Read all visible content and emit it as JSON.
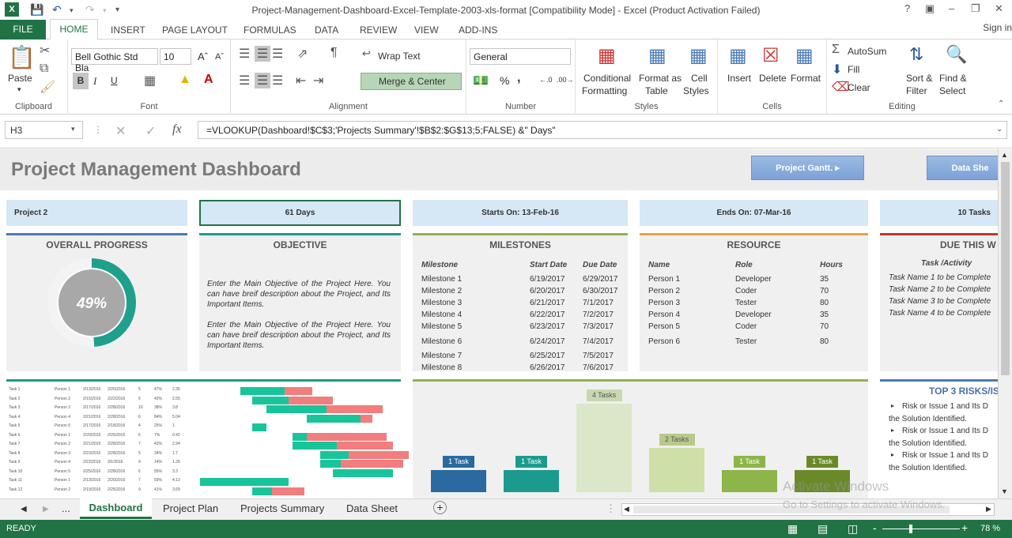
{
  "window": {
    "title": "Project-Management-Dashboard-Excel-Template-2003-xls-format  [Compatibility Mode] - Excel (Product Activation Failed)",
    "help": "?"
  },
  "tabs": {
    "file": "FILE",
    "items": [
      "HOME",
      "INSERT",
      "PAGE LAYOUT",
      "FORMULAS",
      "DATA",
      "REVIEW",
      "VIEW",
      "ADD-INS"
    ],
    "signin": "Sign in"
  },
  "ribbon": {
    "clipboard": {
      "paste": "Paste",
      "label": "Clipboard"
    },
    "font": {
      "family": "Bell Gothic Std Bla",
      "size": "10",
      "label": "Font",
      "bold": "B",
      "italic": "I",
      "underline": "U"
    },
    "alignment": {
      "wrap": "Wrap Text",
      "merge": "Merge & Center",
      "label": "Alignment"
    },
    "number": {
      "format": "General",
      "percent": "%",
      "comma": ",",
      "label": "Number"
    },
    "styles": {
      "conditional": [
        "Conditional",
        "Formatting"
      ],
      "format_table": [
        "Format as",
        "Table"
      ],
      "cell_styles": [
        "Cell",
        "Styles"
      ],
      "label": "Styles"
    },
    "cells": {
      "insert": "Insert",
      "delete": "Delete",
      "format": "Format",
      "label": "Cells"
    },
    "editing": {
      "autosum": "AutoSum",
      "fill": "Fill",
      "clear": "Clear",
      "sort": [
        "Sort &",
        "Filter"
      ],
      "find": [
        "Find &",
        "Select"
      ],
      "label": "Editing"
    }
  },
  "formula_bar": {
    "name_box": "H3",
    "formula": "=VLOOKUP(Dashboard!$C$3;'Projects Summary'!$B$2:$G$13;5;FALSE) &\" Days\""
  },
  "dashboard": {
    "title": "Project Management Dashboard",
    "buttons": [
      "Project Gantt.",
      "Data She"
    ],
    "kpis": [
      "Project 2",
      "61 Days",
      "Starts On: 13-Feb-16",
      "Ends On: 07-Mar-16",
      "10 Tasks"
    ],
    "progress": {
      "title": "OVERALL PROGRESS",
      "value": "49%",
      "fraction": 0.49
    },
    "objective": {
      "title": "OBJECTIVE",
      "paragraphs": [
        "Enter the Main Objective of the Project Here. You can have breif description about the Project, and Its Important Items.",
        "Enter the Main Objective of the Project Here. You can have breif description about the Project, and Its Important Items."
      ]
    },
    "milestones": {
      "title": "MILESTONES",
      "headers": [
        "Milestone",
        "Start Date",
        "Due Date"
      ],
      "rows": [
        [
          "Milestone 1",
          "6/19/2017",
          "6/29/2017"
        ],
        [
          "Milestone 2",
          "6/20/2017",
          "6/30/2017"
        ],
        [
          "Milestone 3",
          "6/21/2017",
          "7/1/2017"
        ],
        [
          "Milestone 4",
          "6/22/2017",
          "7/2/2017"
        ],
        [
          "Milestone 5",
          "6/23/2017",
          "7/3/2017"
        ],
        [
          "Milestone 6",
          "6/24/2017",
          "7/4/2017"
        ],
        [
          "Milestone 7",
          "6/25/2017",
          "7/5/2017"
        ],
        [
          "Milestone 8",
          "6/26/2017",
          "7/6/2017"
        ]
      ]
    },
    "resource": {
      "title": "RESOURCE",
      "headers": [
        "Name",
        "Role",
        "Hours"
      ],
      "rows": [
        [
          "Person 1",
          "Developer",
          "35"
        ],
        [
          "Person 2",
          "Coder",
          "70"
        ],
        [
          "Person 3",
          "Tester",
          "80"
        ],
        [
          "Person 4",
          "Developer",
          "35"
        ],
        [
          "Person 5",
          "Coder",
          "70"
        ],
        [
          "Person 6",
          "Tester",
          "80"
        ]
      ]
    },
    "due": {
      "title": "DUE THIS W",
      "header": "Task /Activity",
      "items": [
        "Task Name 1 to be Complete",
        "Task Name 2 to be Complete",
        "Task Name 3 to be Complete",
        "Task Name 4 to be Complete"
      ]
    },
    "risks": {
      "title": "TOP 3 RISKS/IS",
      "items": [
        [
          "Risk or Issue 1 and Its D",
          "the Solution Identified."
        ],
        [
          "Risk or Issue 1 and Its D",
          "the Solution Identified."
        ],
        [
          "Risk or Issue 1 and Its D",
          "the Solution Identified."
        ]
      ]
    },
    "gantt_rows": [
      [
        "Task 1",
        "Person 1",
        "2/13/2016",
        "2/20/2016",
        "5",
        "47%",
        "2.35"
      ],
      [
        "Task 2",
        "Person 2",
        "2/15/2016",
        "2/22/2016",
        "6",
        "42%",
        "2.55"
      ],
      [
        "Task 3",
        "Person 3",
        "2/17/2016",
        "2/28/2016",
        "10",
        "38%",
        "3.8"
      ],
      [
        "Task 4",
        "Person 4",
        "2/21/2016",
        "2/28/2016",
        "6",
        "84%",
        "5.04"
      ],
      [
        "Task 5",
        "Person 5",
        "2/17/2016",
        "2/18/2016",
        "4",
        "25%",
        "1"
      ],
      [
        "Task 6",
        "Person 1",
        "2/20/2016",
        "2/25/2016",
        "6",
        "7%",
        "0.42"
      ],
      [
        "Task 7",
        "Person 2",
        "2/21/2016",
        "2/28/2016",
        "7",
        "42%",
        "2.94"
      ],
      [
        "Task 8",
        "Person 3",
        "2/23/2016",
        "2/28/2016",
        "5",
        "34%",
        "1.7"
      ],
      [
        "Task 9",
        "Person 4",
        "2/22/2016",
        "3/1/2016",
        "9",
        "14%",
        "1.26"
      ],
      [
        "Task 10",
        "Person 5",
        "2/25/2016",
        "2/28/2016",
        "6",
        "55%",
        "3.3"
      ],
      [
        "Task 11",
        "Person 1",
        "2/13/2016",
        "2/20/2016",
        "7",
        "59%",
        "4.13"
      ],
      [
        "Task 12",
        "Person 2",
        "2/19/2016",
        "2/25/2016",
        "9",
        "41%",
        "3.69"
      ]
    ],
    "gantt_bars": [
      {
        "done": 0.22,
        "rem": 0.14,
        "start": 0.2
      },
      {
        "done": 0.18,
        "rem": 0.22,
        "start": 0.26
      },
      {
        "done": 0.3,
        "rem": 0.28,
        "start": 0.33
      },
      {
        "done": 0.27,
        "rem": 0.06,
        "start": 0.53
      },
      {
        "done": 0.07,
        "rem": 0.0,
        "start": 0.26
      },
      {
        "done": 0.07,
        "rem": 0.4,
        "start": 0.46
      },
      {
        "done": 0.22,
        "rem": 0.28,
        "start": 0.46
      },
      {
        "done": 0.14,
        "rem": 0.3,
        "start": 0.6
      },
      {
        "done": 0.1,
        "rem": 0.31,
        "start": 0.6
      },
      {
        "done": 0.3,
        "rem": 0.0,
        "start": 0.66
      },
      {
        "done": 0.44,
        "rem": 0.0,
        "start": 0.0
      },
      {
        "done": 0.1,
        "rem": 0.16,
        "start": 0.26
      }
    ],
    "task_chart": {
      "labels": [
        "1 Task",
        "1 Task",
        "4 Tasks",
        "2 Tasks",
        "1 Task",
        "1 Task"
      ],
      "values": [
        1,
        1,
        4,
        2,
        1,
        1
      ],
      "colors": [
        "#2a6aa0",
        "#1a9b8e",
        "#dbe7c8",
        "#cfdfa8",
        "#8db54a",
        "#6a8a2a"
      ],
      "label_colors": [
        "#2a6aa0",
        "#1a9b8e",
        "#c9d7b0",
        "#b9c98c",
        "#8db54a",
        "#6a8a2a"
      ]
    }
  },
  "sheet_tabs": {
    "ellipsis": "...",
    "items": [
      "Dashboard",
      "Project Plan",
      "Projects Summary",
      "Data Sheet"
    ],
    "add": "+"
  },
  "status": {
    "ready": "READY",
    "zoom": "78 %",
    "minus": "-",
    "plus": "+"
  },
  "watermark": [
    "Activate Windows",
    "Go to Settings to activate Windows."
  ],
  "colors": {
    "excel_green": "#217346",
    "progress_teal": "#1fa08c",
    "gantt_done": "#19c49b",
    "gantt_rem": "#f17d7d"
  }
}
